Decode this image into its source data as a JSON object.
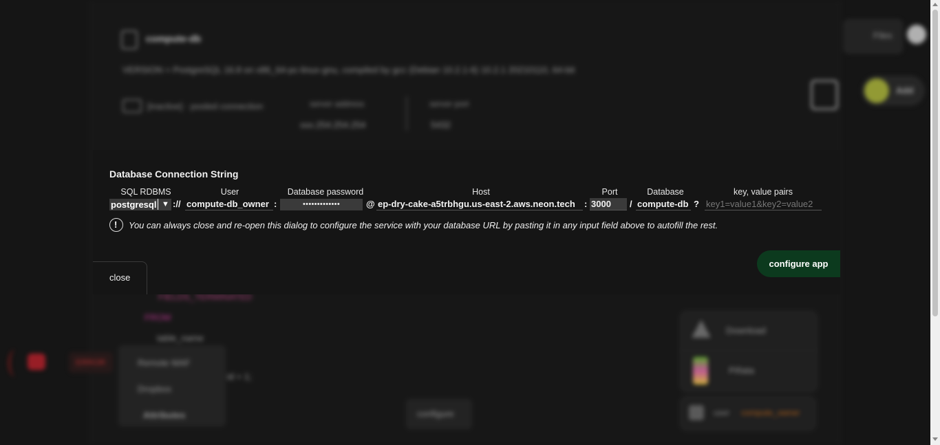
{
  "background": {
    "db_name": "compute-db",
    "version": "VERSION = PostgreSQL 16.8 on x86_64-pc-linux-gnu, compiled by gcc (Debian 10.2.1-6) 10.2.1 20210110, 64-bit",
    "connection_status": "[inactive] · pooled connection",
    "server_address_label": "server address",
    "server_address": "xxx.254.254.254",
    "server_port_label": "server port",
    "server_port": "5432",
    "files_label": "Files",
    "user_label": "Add",
    "code_lines": [
      "FIELDS_TERMINATED",
      "FROM",
      "table_name",
      "id + 1;"
    ],
    "menu_items": [
      "Remote MAF",
      "Dropbox",
      "Attributes"
    ],
    "error_btn": "ERROR",
    "configure_bg": "configure",
    "download_label": "Download",
    "pinata_label": "Piñata",
    "user_card_user": "user",
    "user_card_owner": "compute_owner",
    "accent_orange": "#c76a1a"
  },
  "dialog": {
    "title": "Database Connection String",
    "labels": {
      "sql_rdbms": "SQL RDBMS",
      "user": "User",
      "password": "Database password",
      "host": "Host",
      "port": "Port",
      "database": "Database",
      "kv": "key, value pairs"
    },
    "values": {
      "rdbms": "postgresql",
      "scheme_sep": "://",
      "user": "compute-db_owner",
      "user_sep": ":",
      "password_mask": "•••••••••••••",
      "at": "@",
      "host": "ep-dry-cake-a5trbhgu.us-east-2.aws.neon.tech",
      "host_sep": ":",
      "port": "3000",
      "db_sep": "/",
      "database": "compute-db",
      "kv_sep": "?",
      "kv_placeholder": "key1=value1&key2=value2"
    },
    "info": "You can always close and re-open this dialog to configure the service with your database URL by pasting it in any input field above to autofill the rest.",
    "configure_button": "configure app",
    "close_button": "close",
    "accent_green": "#0c3a1e"
  }
}
